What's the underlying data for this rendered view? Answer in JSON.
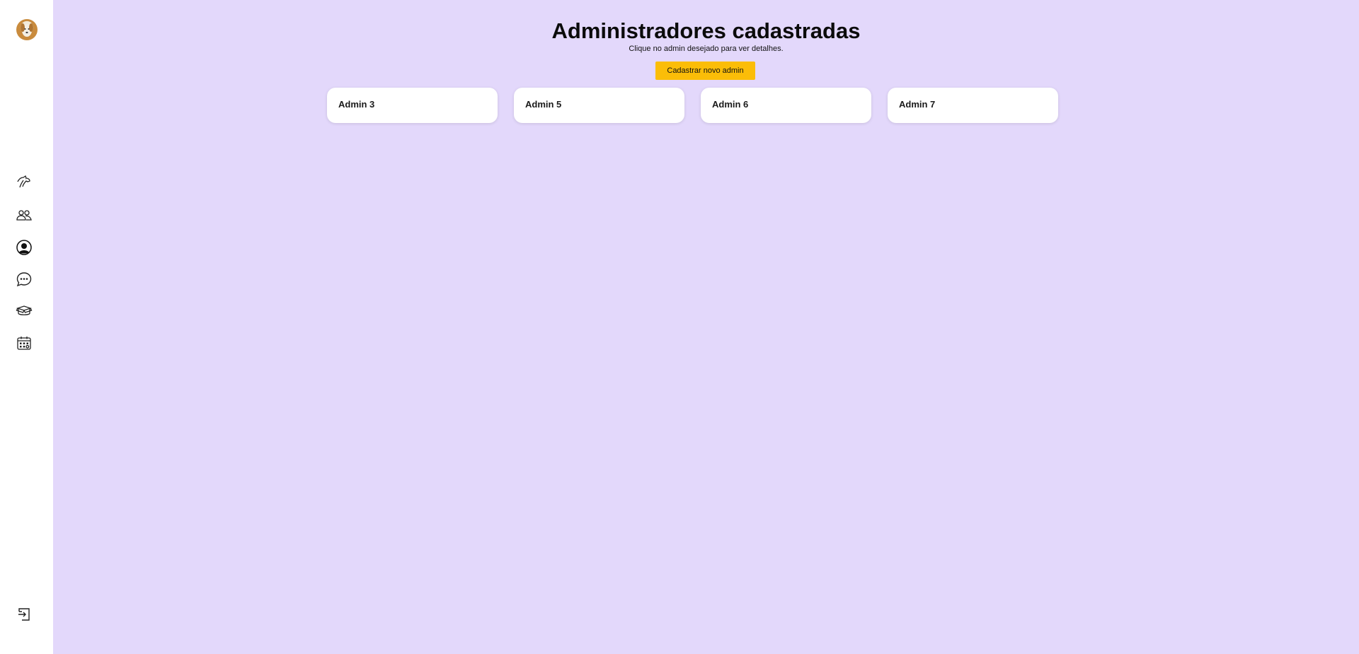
{
  "sidebar": {
    "icons": [
      "dog-icon",
      "users-icon",
      "user-circle-icon",
      "chat-icon",
      "box-icon",
      "calendar-icon",
      "logout-icon"
    ]
  },
  "page": {
    "title": "Administradores cadastradas",
    "subtitle": "Clique no admin desejado para ver detalhes.",
    "new_button_label": "Cadastrar novo admin"
  },
  "admins": [
    {
      "name": "Admin 3"
    },
    {
      "name": "Admin 5"
    },
    {
      "name": "Admin 6"
    },
    {
      "name": "Admin 7"
    }
  ],
  "colors": {
    "background": "#e3d8fb",
    "accent_button": "#fbbd08",
    "card": "#ffffff"
  }
}
